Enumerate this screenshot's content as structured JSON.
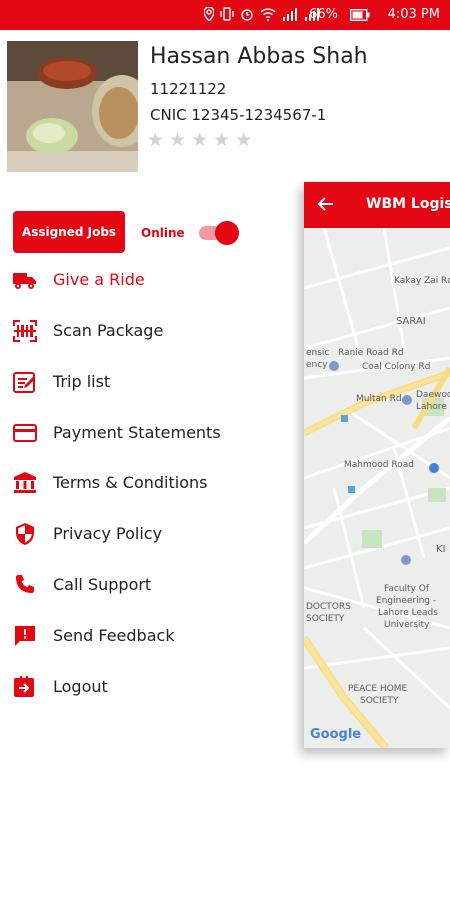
{
  "status_bar": {
    "battery": "66%",
    "time": "4:03 PM"
  },
  "colors": {
    "primary": "#e30613",
    "inactive_star": "#d2d2d2"
  },
  "profile": {
    "name": "Hassan Abbas Shah",
    "id": "11221122",
    "cnic": "CNIC 12345-1234567-1",
    "rating": 0,
    "max_rating": 5
  },
  "assigned_jobs_label": "Assigned Jobs",
  "online": {
    "label": "Online",
    "enabled": true
  },
  "menu": [
    {
      "label": "Give a Ride",
      "icon": "truck-icon",
      "active": true
    },
    {
      "label": "Scan Package",
      "icon": "scan-icon",
      "active": false
    },
    {
      "label": "Trip list",
      "icon": "trip-list-icon",
      "active": false
    },
    {
      "label": "Payment Statements",
      "icon": "credit-card-icon",
      "active": false
    },
    {
      "label": "Terms & Conditions",
      "icon": "bank-icon",
      "active": false
    },
    {
      "label": "Privacy Policy",
      "icon": "shield-icon",
      "active": false
    },
    {
      "label": "Call Support",
      "icon": "phone-icon",
      "active": false
    },
    {
      "label": "Send Feedback",
      "icon": "feedback-icon",
      "active": false
    },
    {
      "label": "Logout",
      "icon": "logout-icon",
      "active": false
    }
  ],
  "map": {
    "toolbar_title": "WBM Logist",
    "labels": {
      "kakay": "Kakay Zai Rd",
      "sarai": "SARAI",
      "ranie": "Ranie Road Rd",
      "ensic": "ensic",
      "ency": "ency",
      "coal": "Coal Colony Rd",
      "multan": "Multan Rd",
      "daewoo": "Daewoo",
      "lahore": "Lahore",
      "mahmood": "Mahmood Road",
      "ki": "KI",
      "faculty1": "Faculty Of",
      "faculty2": "Engineering -",
      "faculty3": "Lahore Leads",
      "faculty4": "University",
      "doctors1": "DOCTORS",
      "doctors2": "SOCIETY",
      "peace1": "PEACE HOME",
      "peace2": "SOCIETY"
    },
    "attribution": "Google"
  }
}
